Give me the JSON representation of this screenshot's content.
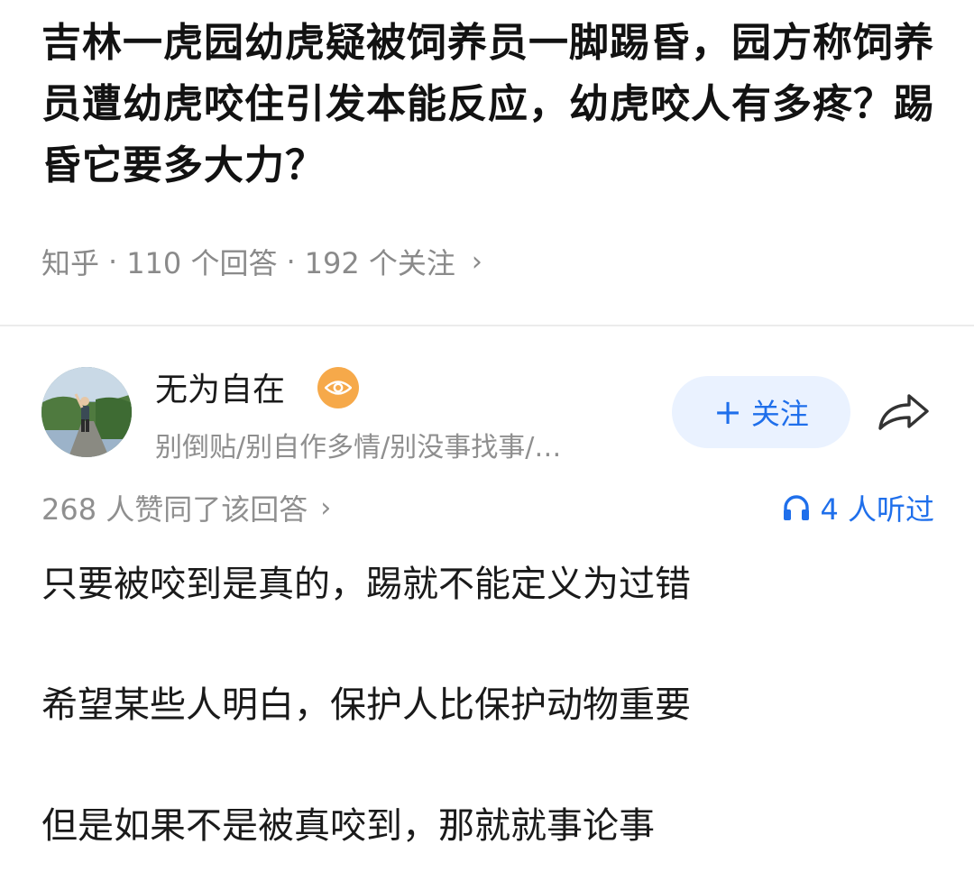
{
  "question": {
    "title": "吉林一虎园幼虎疑被饲养员一脚踢昏，园方称饲养员遭幼虎咬住引发本能反应，幼虎咬人有多疼？踢昏它要多大力？",
    "source": "知乎",
    "answer_count": "110 个回答",
    "follower_count": "192 个关注",
    "meta_chevron": "›"
  },
  "author": {
    "name": "无为自在",
    "bio": "别倒贴/别自作多情/别没事找事/…",
    "avatar_icon": "avatar-photo",
    "badge_icon": "eye-badge-icon",
    "badge_color": "#f6a94a"
  },
  "actions": {
    "follow_plus": "+",
    "follow_label": "关注",
    "share_icon": "share-icon",
    "accent_color": "#1f6feb"
  },
  "stats": {
    "upvote_text": "268 人赞同了该回答",
    "upvote_chevron": "›",
    "listen_text": "4 人听过",
    "listen_icon": "headphones-icon"
  },
  "answer": {
    "paragraphs": [
      "只要被咬到是真的，踢就不能定义为过错",
      "希望某些人明白，保护人比保护动物重要",
      "但是如果不是被真咬到，那就就事论事"
    ]
  }
}
